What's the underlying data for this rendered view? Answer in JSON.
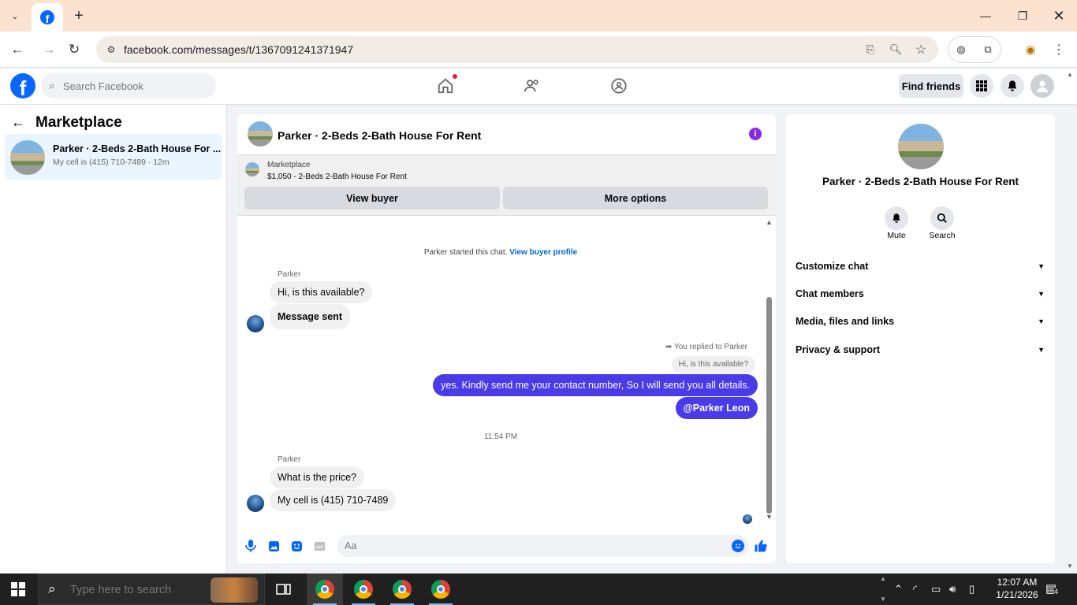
{
  "browser": {
    "url": "facebook.com/messages/t/1367091241371947"
  },
  "fb": {
    "search_placeholder": "Search Facebook",
    "find_friends": "Find friends"
  },
  "left": {
    "title": "Marketplace",
    "conversation": {
      "title": "Parker · 2-Beds 2-Bath House For ...",
      "preview": "My cell is (415) 710-7489 · 12m"
    }
  },
  "chat": {
    "title": "Parker · 2-Beds 2-Bath House For Rent",
    "marketplace_label": "Marketplace",
    "listing": "$1,050 - 2-Beds 2-Bath House For Rent",
    "view_buyer": "View buyer",
    "more_options": "More options",
    "system_text": "Parker started this chat.",
    "system_link": "View buyer profile",
    "sender1": "Parker",
    "msg1": "Hi, is this available?",
    "msg2": "Message sent",
    "replied_label": "You replied to Parker",
    "quoted": "Hi, is this available?",
    "out1": "yes. Kindly send me your contact number, So I will send you all details.",
    "out2": "@Parker Leon",
    "time": "11:54 PM",
    "sender2": "Parker",
    "msg3": "What is the price?",
    "msg4": "My cell is (415) 710-7489",
    "composer_placeholder": "Aa"
  },
  "right": {
    "name": "Parker · 2-Beds 2-Bath House For Rent",
    "mute": "Mute",
    "search": "Search",
    "rows": [
      "Customize chat",
      "Chat members",
      "Media, files and links",
      "Privacy & support"
    ]
  },
  "taskbar": {
    "search_placeholder": "Type here to search",
    "time": "12:07 AM",
    "date": "1/21/2026",
    "notifications": "4"
  },
  "colors": {
    "fb_blue": "#0866ff",
    "outgoing_bubble": "#4a3be8",
    "info_purple": "#8a2be2"
  }
}
